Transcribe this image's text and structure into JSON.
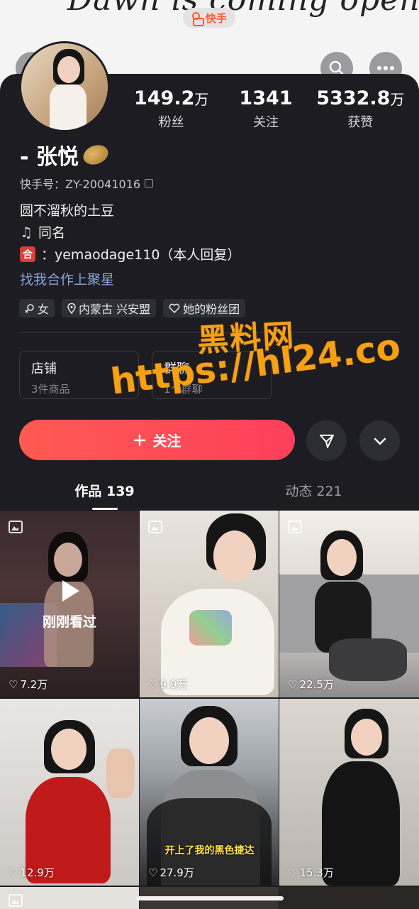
{
  "cover": {
    "text": "Dawn is coming open your eyes.",
    "brand": "快手"
  },
  "profile": {
    "name": "- 张悦",
    "uid_label": "快手号：ZY-20041016",
    "bio_line1": "圆不溜秋的土豆",
    "bio_line2": "同名",
    "bio_line3": "：yemaodage110（本人回复）",
    "he_badge": "合",
    "link": "找我合作上聚星"
  },
  "stats": [
    {
      "value": "149.2",
      "unit": "万",
      "label": "粉丝"
    },
    {
      "value": "1341",
      "unit": "",
      "label": "关注"
    },
    {
      "value": "5332.8",
      "unit": "万",
      "label": "获赞"
    }
  ],
  "tags": [
    {
      "icon": "gender-icon",
      "label": "女"
    },
    {
      "icon": "location-icon",
      "label": "内蒙古 兴安盟"
    },
    {
      "icon": "heart-icon",
      "label": "她的粉丝团"
    }
  ],
  "cards": [
    {
      "title": "店铺",
      "sub": "3件商品"
    },
    {
      "title": "群聊",
      "sub": "1个群聊"
    }
  ],
  "follow": {
    "label": "关注"
  },
  "tabs": [
    {
      "label": "作品 139"
    },
    {
      "label": "动态 221"
    }
  ],
  "watermark": {
    "line1": "黑料网",
    "line2": "https://hl24.co"
  },
  "posts": [
    {
      "likes": "7.2万",
      "overlay": "刚刚看过",
      "caption": ""
    },
    {
      "likes": "9.9万",
      "overlay": "",
      "caption": ""
    },
    {
      "likes": "22.5万",
      "overlay": "",
      "caption": ""
    },
    {
      "likes": "12.9万",
      "overlay": "",
      "caption": ""
    },
    {
      "likes": "27.9万",
      "overlay": "",
      "caption": "开上了我的黑色捷达"
    },
    {
      "likes": "15.3万",
      "overlay": "",
      "caption": ""
    }
  ]
}
